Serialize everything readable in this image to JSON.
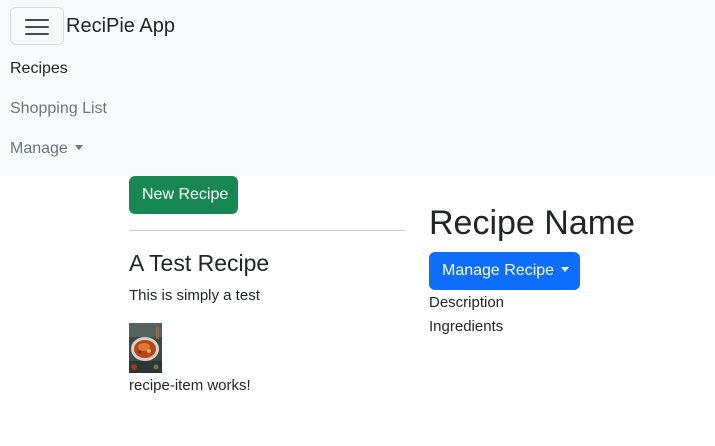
{
  "navbar": {
    "brand": "ReciPie App",
    "toggler_icon": "hamburger-menu-icon",
    "links": {
      "recipes": "Recipes",
      "shopping_list": "Shopping List",
      "manage": "Manage"
    },
    "caret_icon": "caret-down-icon"
  },
  "recipe_list": {
    "new_recipe_button": "New Recipe",
    "items": [
      {
        "name": "A Test Recipe",
        "description": "This is simply a test",
        "image_icon": "recipe-thumbnail-image",
        "footer_text": "recipe-item works!"
      }
    ]
  },
  "recipe_detail": {
    "name": "Recipe Name",
    "manage_button": "Manage Recipe",
    "description_label": "Description",
    "ingredients_label": "Ingredients"
  },
  "colors": {
    "navbar_bg": "#f8f9fa",
    "success": "#198754",
    "primary": "#0d6efd",
    "muted_link": "#6c757d",
    "text": "#212529"
  }
}
